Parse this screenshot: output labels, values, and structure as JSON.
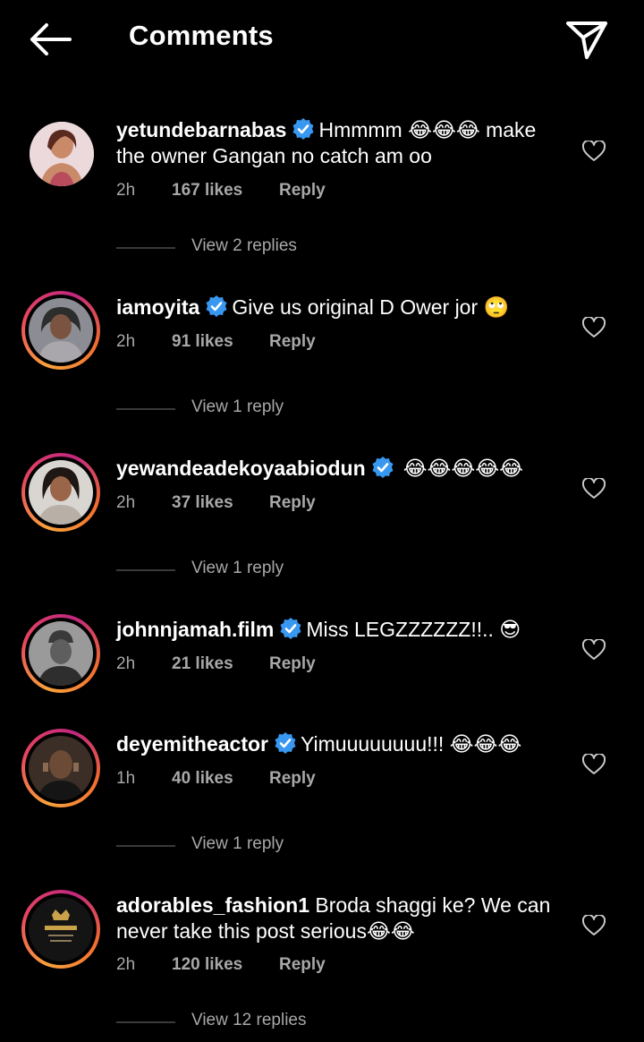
{
  "header": {
    "title": "Comments",
    "back_icon": "arrow-left-icon",
    "send_icon": "paper-plane-icon"
  },
  "theme": {
    "background": "#000000",
    "text": "#ffffff",
    "secondary": "#a8a8a8",
    "verified": "#3897f0"
  },
  "comments": [
    {
      "username": "yetundebarnabas",
      "verified": true,
      "text": "Hmmmm 😂😂😂 make the owner Gangan no catch am oo",
      "time": "2h",
      "likes": "167 likes",
      "reply": "Reply",
      "view_replies": "View 2 replies",
      "story_ring": false
    },
    {
      "username": "iamoyita",
      "verified": true,
      "text": "Give us original D Ower jor 🙄",
      "time": "2h",
      "likes": "91 likes",
      "reply": "Reply",
      "view_replies": "View 1 reply",
      "story_ring": true
    },
    {
      "username": "yewandeadekoyaabiodun",
      "verified": true,
      "text": "😂😂😂😂😂",
      "time": "2h",
      "likes": "37 likes",
      "reply": "Reply",
      "view_replies": "View 1 reply",
      "story_ring": true
    },
    {
      "username": "johnnjamah.film",
      "verified": true,
      "text": "Miss LEGZZZZZZ!!.. 😎",
      "time": "2h",
      "likes": "21 likes",
      "reply": "Reply",
      "view_replies": "",
      "story_ring": true
    },
    {
      "username": "deyemitheactor",
      "verified": true,
      "text": "Yimuuuuuuuu!!! 😂😂😂",
      "time": "1h",
      "likes": "40 likes",
      "reply": "Reply",
      "view_replies": "View 1 reply",
      "story_ring": true
    },
    {
      "username": "adorables_fashion1",
      "verified": false,
      "text": "Broda shaggi ke? We can never take this post serious😂😂",
      "time": "2h",
      "likes": "120 likes",
      "reply": "Reply",
      "view_replies": "View 12 replies",
      "story_ring": true
    }
  ]
}
